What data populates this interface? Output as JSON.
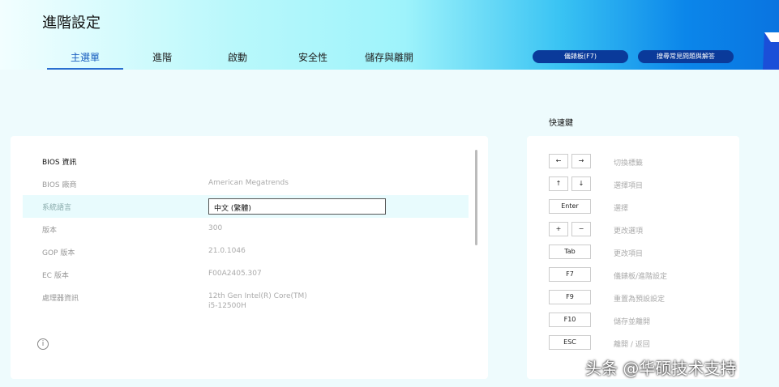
{
  "header": {
    "title": "進階設定",
    "tabs": [
      "主選單",
      "進階",
      "啟動",
      "安全性",
      "儲存與離開"
    ],
    "buttons": {
      "dashboard": "儀錶板(F7)",
      "faq": "搜尋常見問題與解答"
    }
  },
  "bios": {
    "section": "BIOS 資訊",
    "rows": [
      {
        "label": "BIOS 廠商",
        "value": "American Megatrends"
      },
      {
        "label": "系統語言",
        "value": "中文 (繁體)"
      },
      {
        "label": "版本",
        "value": "300"
      },
      {
        "label": "GOP 版本",
        "value": "21.0.1046"
      },
      {
        "label": "EC 版本",
        "value": "F00A2405.307"
      },
      {
        "label": "處理器資訊",
        "value": "12th Gen Intel(R) Core(TM)",
        "value2": "i5-12500H"
      }
    ]
  },
  "hotkeys": {
    "title": "快速鍵",
    "items": [
      {
        "keys": [
          "←",
          "→"
        ],
        "desc": "切換標籤"
      },
      {
        "keys": [
          "↑",
          "↓"
        ],
        "desc": "選擇項目"
      },
      {
        "keys": [
          "Enter"
        ],
        "desc": "選擇"
      },
      {
        "keys": [
          "+",
          "−"
        ],
        "desc": "更改選項"
      },
      {
        "keys": [
          "Tab"
        ],
        "desc": "更改項目"
      },
      {
        "keys": [
          "F7"
        ],
        "desc": "儀錶板/進階設定"
      },
      {
        "keys": [
          "F9"
        ],
        "desc": "重置為預設設定"
      },
      {
        "keys": [
          "F10"
        ],
        "desc": "儲存並離開"
      },
      {
        "keys": [
          "ESC"
        ],
        "desc": "離開 / 返回"
      }
    ]
  },
  "watermark": "头条 @华硕技术支持"
}
